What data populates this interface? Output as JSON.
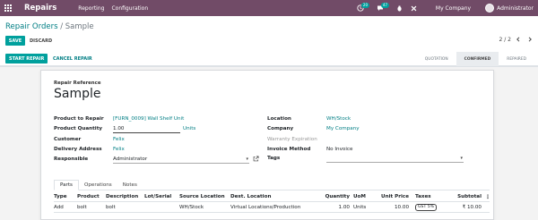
{
  "navbar": {
    "brand": "Repairs",
    "menu": [
      "Reporting",
      "Configuration"
    ],
    "activity_count": "20",
    "messages_count": "47",
    "company": "My Company",
    "user": "Administrator"
  },
  "breadcrumb": {
    "parent": "Repair Orders",
    "separator": "/",
    "current": "Sample"
  },
  "actions": {
    "save": "SAVE",
    "discard": "DISCARD"
  },
  "pager": {
    "text": "2 / 2",
    "prev": "‹",
    "next": "›"
  },
  "statusbar": {
    "start": "START REPAIR",
    "cancel": "CANCEL REPAIR",
    "stages": [
      "QUOTATION",
      "CONFIRMED",
      "REPAIRED"
    ],
    "active_stage": "CONFIRMED"
  },
  "form": {
    "ref_label": "Repair Reference",
    "ref_name": "Sample",
    "left": {
      "product_label": "Product to Repair",
      "product_value": "[FURN_0009] Wall Shelf Unit",
      "qty_label": "Product Quantity",
      "qty_value": "1.00",
      "qty_uom": "Units",
      "customer_label": "Customer",
      "customer_value": "Felix",
      "delivery_label": "Delivery Address",
      "delivery_value": "Felix",
      "responsible_label": "Responsible",
      "responsible_value": "Administrator"
    },
    "right": {
      "location_label": "Location",
      "location_value": "WH/Stock",
      "company_label": "Company",
      "company_value": "My Company",
      "warranty_label": "Warranty Expiration",
      "invoice_label": "Invoice Method",
      "invoice_value": "No Invoice",
      "tags_label": "Tags"
    }
  },
  "tabs": [
    "Parts",
    "Operations",
    "Notes"
  ],
  "table": {
    "headers": [
      "Type",
      "Product",
      "Description",
      "Lot/Serial",
      "Source Location",
      "Dest. Location",
      "Quantity",
      "UoM",
      "Unit Price",
      "Taxes",
      "Subtotal"
    ],
    "rows": [
      {
        "type": "Add",
        "product": "bolt",
        "description": "bolt",
        "lot": "",
        "source": "WH/Stock",
        "dest": "Virtual Locations/Production",
        "quantity": "1.00",
        "uom": "Units",
        "unit_price": "10.00",
        "taxes": "GST 5%",
        "subtotal": "₹ 10.00"
      }
    ]
  },
  "colors": {
    "navbar": "#714b67",
    "primary": "#00a09d",
    "link": "#017e84"
  },
  "icons": [
    "app-grid-icon",
    "activity-icon",
    "chat-icon",
    "bug-icon",
    "close-icon",
    "external-link-icon",
    "optional-columns-icon"
  ]
}
